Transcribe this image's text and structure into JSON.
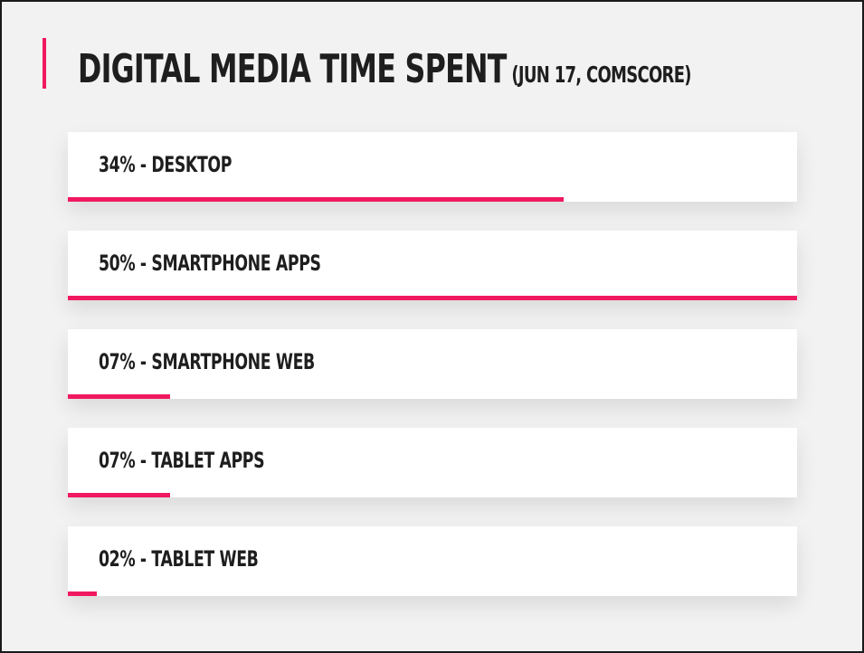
{
  "title": {
    "main": "DIGITAL MEDIA TIME SPENT",
    "sub": "(JUN 17, COMSCORE)"
  },
  "colors": {
    "accent": "#f0195f",
    "background": "#f2f2f2",
    "text": "#1e1e1e"
  },
  "chart_data": {
    "type": "bar",
    "title": "DIGITAL MEDIA TIME SPENT (JUN 17, COMSCORE)",
    "categories": [
      "DESKTOP",
      "SMARTPHONE APPS",
      "SMARTPHONE WEB",
      "TABLET APPS",
      "TABLET WEB"
    ],
    "values": [
      34,
      50,
      7,
      7,
      2
    ],
    "labels": [
      "34% - DESKTOP",
      "50% - SMARTPHONE APPS",
      "07% - SMARTPHONE WEB",
      "07% - TABLET APPS",
      "02% - TABLET WEB"
    ],
    "xlim": [
      0,
      50
    ],
    "orientation": "horizontal",
    "unit": "%"
  }
}
